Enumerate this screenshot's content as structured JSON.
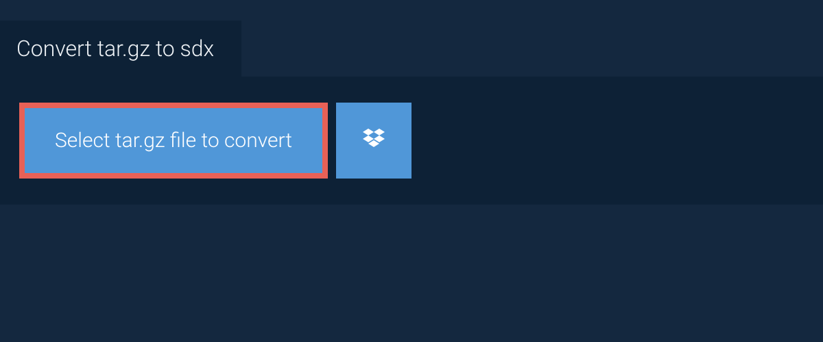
{
  "header": {
    "title": "Convert tar.gz to sdx"
  },
  "actions": {
    "select_file_label": "Select tar.gz file to convert",
    "dropbox_icon": "dropbox-icon"
  },
  "colors": {
    "background": "#14283f",
    "panel": "#0d2136",
    "button": "#5097d8",
    "highlight_border": "#e86157",
    "text_light": "#eef2f6"
  }
}
